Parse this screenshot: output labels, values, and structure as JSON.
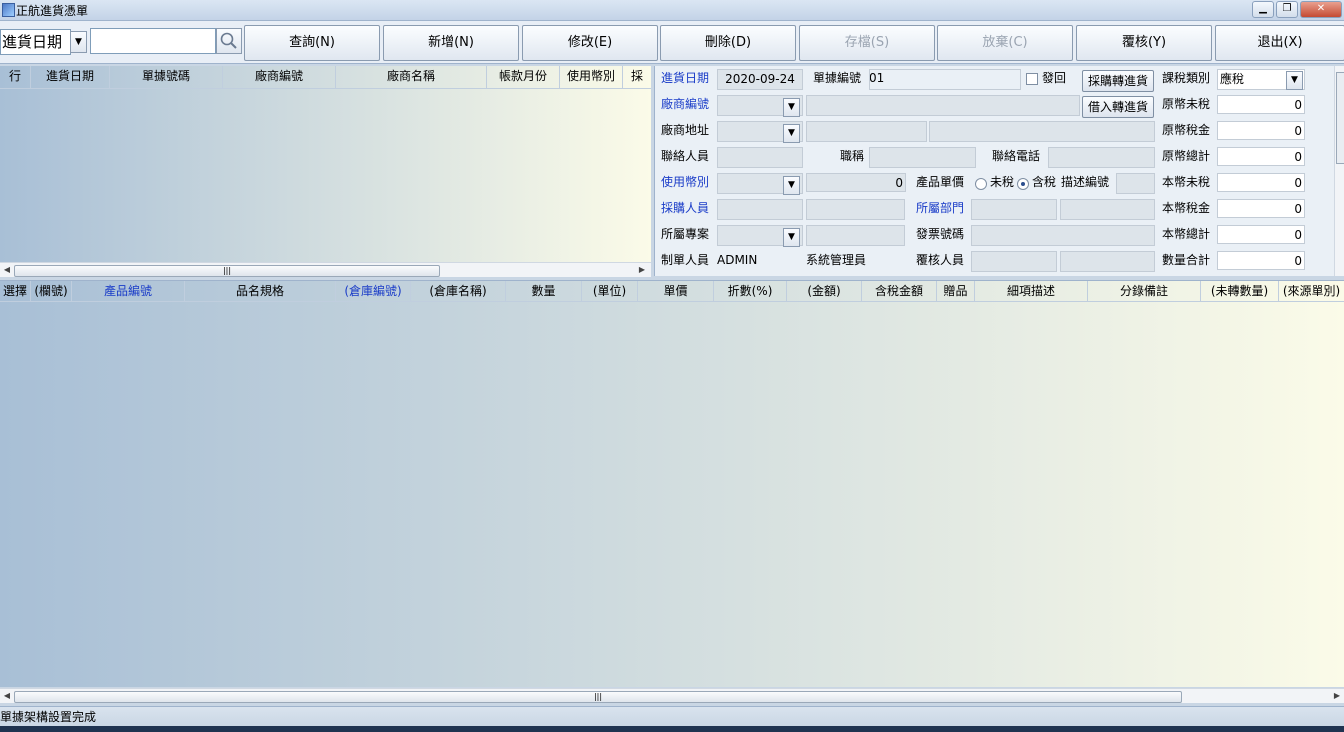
{
  "window": {
    "title": "正航進貨憑單"
  },
  "toolbar": {
    "search_field": "進貨日期",
    "search_value": "",
    "buttons": {
      "query": "查詢(N)",
      "add": "新增(N)",
      "edit": "修改(E)",
      "delete": "刪除(D)",
      "save": "存檔(S)",
      "discard": "放棄(C)",
      "review": "覆核(Y)",
      "exit": "退出(X)"
    }
  },
  "list": {
    "columns": [
      "行",
      "進貨日期",
      "單據號碼",
      "廠商編號",
      "廠商名稱",
      "帳款月份",
      "使用幣別",
      "採"
    ]
  },
  "form": {
    "date_label": "進貨日期",
    "date_value": "2020-09-24",
    "docno_label": "單據編號",
    "docno_value": "01",
    "return_label": "發回",
    "btn_po_to_receipt": "採購轉進貨",
    "btn_borrow_to_receipt": "借入轉進貨",
    "tax_type_label": "課稅類別",
    "tax_type_value": "應稅",
    "vendor_code_label": "廠商編號",
    "vendor_addr_label": "廠商地址",
    "contact_label": "聯絡人員",
    "title_label": "職稱",
    "phone_label": "聯絡電話",
    "currency_label": "使用幣別",
    "currency_rate": "0",
    "unit_price_label": "產品單價",
    "untaxed_option": "未稅",
    "taxed_option": "含稅",
    "desc_code_label": "描述編號",
    "buyer_label": "採購人員",
    "dept_label": "所屬部門",
    "project_label": "所屬專案",
    "invoice_label": "發票號碼",
    "maker_label": "制單人員",
    "maker_value": "ADMIN",
    "maker_name": "系統管理員",
    "reviewer_label": "覆核人員",
    "totals": [
      {
        "label": "原幣未稅",
        "value": "0"
      },
      {
        "label": "原幣稅金",
        "value": "0"
      },
      {
        "label": "原幣總計",
        "value": "0"
      },
      {
        "label": "本幣未稅",
        "value": "0"
      },
      {
        "label": "本幣稅金",
        "value": "0"
      },
      {
        "label": "本幣總計",
        "value": "0"
      },
      {
        "label": "數量合計",
        "value": "0"
      }
    ]
  },
  "detail": {
    "columns": [
      "選擇",
      "(欄號)",
      "產品編號",
      "品名規格",
      "(倉庫編號)",
      "(倉庫名稱)",
      "數量",
      "(單位)",
      "單價",
      "折數(%)",
      "(金額)",
      "含稅金額",
      "贈品",
      "細項描述",
      "分錄備註",
      "(未轉數量)",
      "(來源單別)"
    ]
  },
  "status": {
    "message": "單據架構設置完成"
  }
}
